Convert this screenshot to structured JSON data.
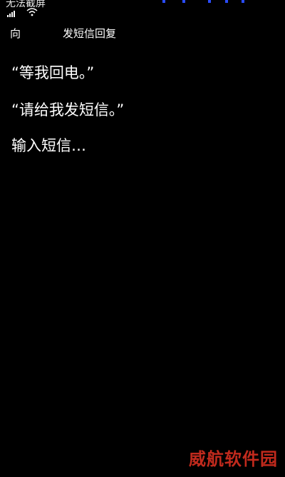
{
  "status_bar": {
    "text": "无法截屏",
    "signal_icon": "signal-strength-icon",
    "wifi_icon": "wifi-icon",
    "indicator_color": "#2a4cff"
  },
  "header": {
    "left_label": "向",
    "title": "发短信回复"
  },
  "options": [
    {
      "label": "“等我回电。”"
    },
    {
      "label": "“请给我发短信。”"
    },
    {
      "label": "输入短信…"
    }
  ],
  "watermark": {
    "text": "威航软件园",
    "color": "#c12a1d"
  }
}
